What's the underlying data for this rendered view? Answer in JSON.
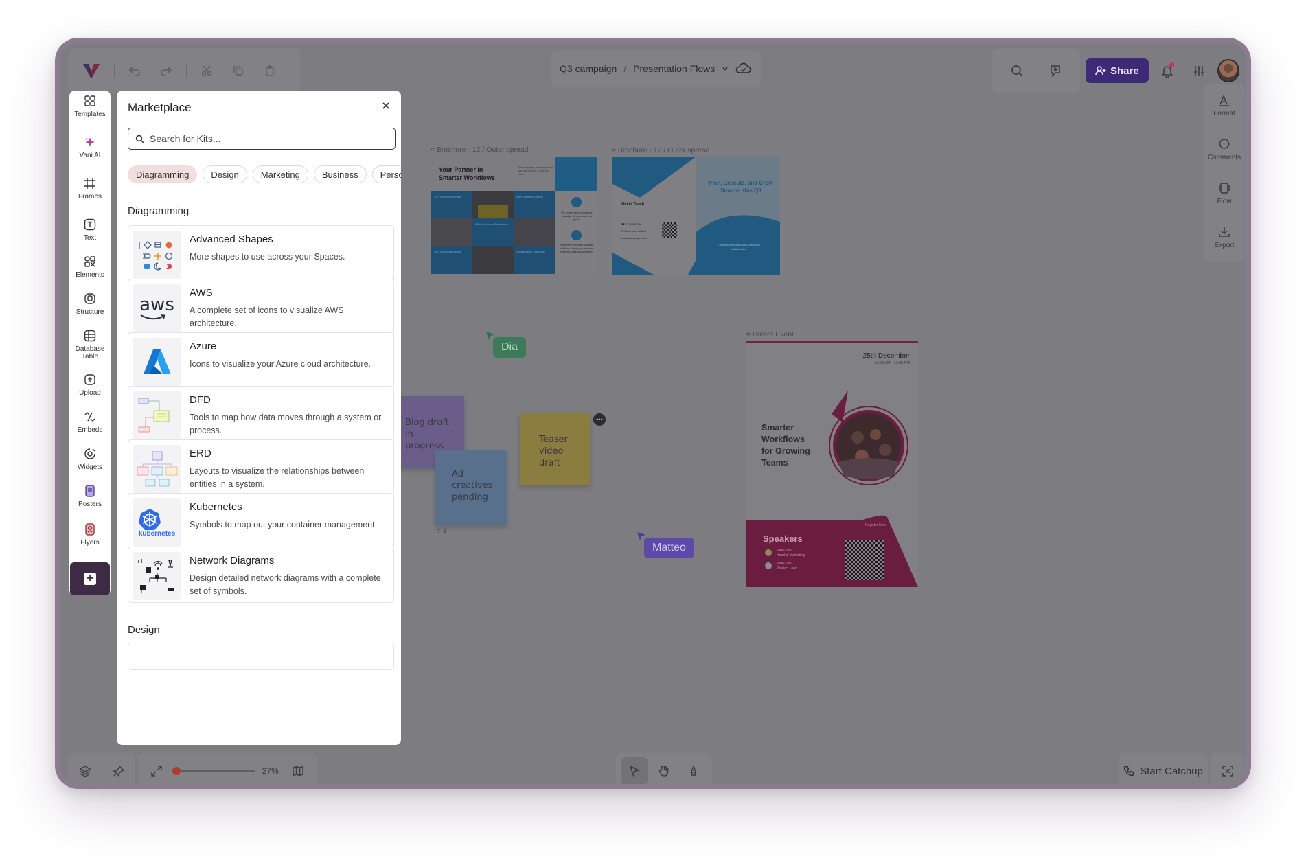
{
  "header": {
    "breadcrumb_project": "Q3 campaign",
    "breadcrumb_separator": "/",
    "breadcrumb_space": "Presentation Flows",
    "share_label": "Share"
  },
  "left_rail": {
    "items": [
      {
        "label": "Templates",
        "icon": "grid-icon"
      },
      {
        "label": "Vani AI",
        "icon": "sparkle-icon"
      },
      {
        "label": "Frames",
        "icon": "frame-icon"
      },
      {
        "label": "Text",
        "icon": "text-icon"
      },
      {
        "label": "Elements",
        "icon": "shapes-icon"
      },
      {
        "label": "Structure",
        "icon": "structure-icon"
      },
      {
        "label": "Database Table",
        "icon": "database-icon"
      },
      {
        "label": "Upload",
        "icon": "upload-icon"
      },
      {
        "label": "Embeds",
        "icon": "embed-icon"
      },
      {
        "label": "Widgets",
        "icon": "widget-icon"
      },
      {
        "label": "Posters",
        "icon": "poster-icon"
      },
      {
        "label": "Flyers",
        "icon": "flyer-icon"
      }
    ]
  },
  "right_rail": {
    "items": [
      {
        "label": "Format",
        "icon": "format-icon"
      },
      {
        "label": "Comments",
        "icon": "comment-icon"
      },
      {
        "label": "Flow",
        "icon": "flow-icon"
      },
      {
        "label": "Export",
        "icon": "export-icon"
      }
    ]
  },
  "marketplace": {
    "title": "Marketplace",
    "search_placeholder": "Search for Kits...",
    "chips": [
      {
        "label": "Diagramming",
        "active": true
      },
      {
        "label": "Design",
        "active": false
      },
      {
        "label": "Marketing",
        "active": false
      },
      {
        "label": "Business",
        "active": false
      },
      {
        "label": "Personal",
        "active": false
      }
    ],
    "section_diagramming": "Diagramming",
    "section_design": "Design",
    "kits": [
      {
        "name": "Advanced Shapes",
        "description": "More shapes to use across your Spaces."
      },
      {
        "name": "AWS",
        "description": "A complete set of icons to visualize AWS architecture.",
        "logo_text": "aws"
      },
      {
        "name": "Azure",
        "description": "Icons to visualize your Azure cloud architecture."
      },
      {
        "name": "DFD",
        "description": "Tools to map how data moves through a system or process."
      },
      {
        "name": "ERD",
        "description": "Layouts to visualize the relationships between entities in a system."
      },
      {
        "name": "Kubernetes",
        "description": "Symbols to map out your container management.",
        "logo_text": "kubernetes"
      },
      {
        "name": "Network Diagrams",
        "description": "Design detailed network diagrams with a complete set of symbols."
      }
    ]
  },
  "canvas": {
    "frames": [
      {
        "label": "Brochure - 12 / Outer spread"
      },
      {
        "label": "Brochure - 12 / Outer spread"
      },
      {
        "label": "Poster Event"
      }
    ],
    "brochure_1": {
      "headline": "Your Partner in Smarter Workflows",
      "intro": "Plan campaigns, execute projects, and track results — all in one place.",
      "stat_1": "10+ Years Experience",
      "stat_2": "98% Customer Satisfaction",
      "stat_3": "500+ Satisfied Clients",
      "stat_4": "24/7 Support Available",
      "stat_5": "Collaborative Solutions",
      "blurb_1": "We provide tailored solutions that align with your business goals.",
      "blurb_2": "We deliver innovative, scalable solutions to help your business excel with data-driven insights."
    },
    "brochure_2": {
      "headline": "Plan, Execute, and Grow Smarter this Q3",
      "contact_title": "Get in Touch",
      "phone": "1123456789",
      "email": "Enter your mail id",
      "web": "www.example.com",
      "tagline": "Empowering teams with clarity and collaboration."
    },
    "poster": {
      "date": "25th December",
      "time": "10:00 AM - 12:00 PM",
      "headline": "Smarter Workflows for Growing Teams",
      "speakers_title": "Speakers",
      "register": "Register Now",
      "speaker_1_name": "Jane Doe",
      "speaker_1_role": "Head of Marketing",
      "speaker_2_name": "John Doe",
      "speaker_2_role": "Product Lead"
    },
    "stickies": [
      {
        "text": "Blog draft in progress",
        "color": "#6b5d89"
      },
      {
        "text": "Ad creatives pending",
        "color": "#59708d"
      },
      {
        "text": "Teaser video draft",
        "color": "#8a7d3f"
      }
    ],
    "sticky_vote_count": "3",
    "cursors": [
      {
        "name": "Dia",
        "color": "#3d7a59"
      },
      {
        "name": "Matteo",
        "color": "#5b4aa8"
      }
    ]
  },
  "bottom": {
    "zoom": "27%",
    "catchup_label": "Start Catchup"
  }
}
